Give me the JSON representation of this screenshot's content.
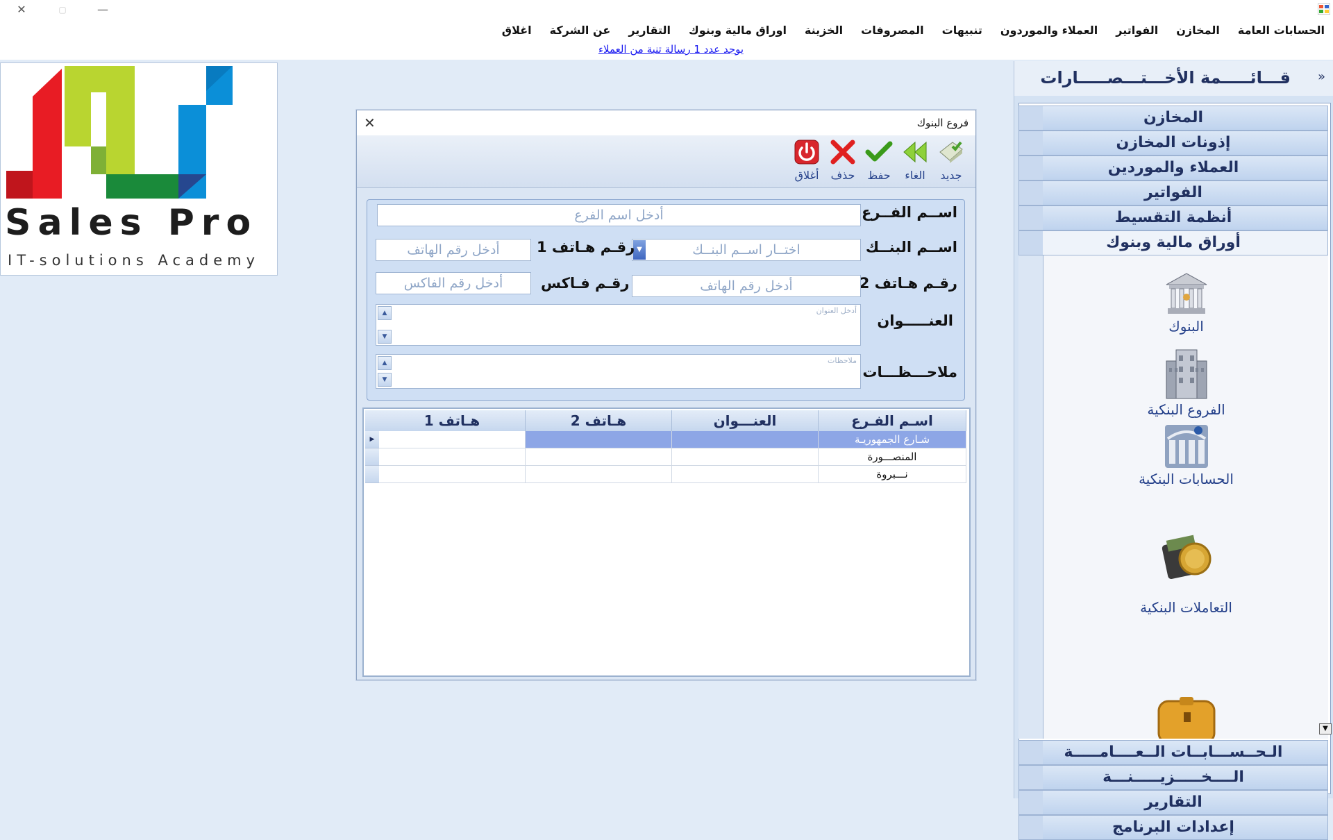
{
  "window": {
    "close_icon": "close-icon",
    "maximize_icon": "maximize-icon",
    "minimize_icon": "minimize-icon"
  },
  "menu": {
    "items": [
      "الحسابات العامة",
      "المخازن",
      "الفواتير",
      "العملاء والموردون",
      "تنبيهات",
      "المصروفات",
      "الخزينة",
      "اوراق مالية وبنوك",
      "التقارير",
      "عن الشركة",
      "اغلاق"
    ]
  },
  "notice": {
    "text": "يوجد عدد  1 رسالة تنبة من العملاء"
  },
  "logo": {
    "text": "Sales Pro",
    "subtext": "IT-solutions Academy",
    "colors": [
      "#e81c24",
      "#b9d530",
      "#1a8a3a",
      "#0b8fd8",
      "#26478f"
    ]
  },
  "sidebar": {
    "title": "قـــائـــــمة الأخـــتـــصـــــارات",
    "groups_top": [
      "المخازن",
      "إذونات المخازن",
      "العملاء والموردين",
      "الفواتير",
      "أنظمة التقسيط",
      "أوراق مالية وبنوك"
    ],
    "sub_items": [
      "البنوك",
      "الفروع البنكية",
      "الحسابات البنكية",
      "التعاملات البنكية"
    ],
    "groups_bottom": [
      "الـحــســـابــات الــعــــامـــــة",
      "الــــخـــــزيـــــنـــة",
      "التقارير",
      "إعدادات البرنامج"
    ]
  },
  "dialog": {
    "title": "فروع البنوك",
    "toolbar": {
      "new": "جديد",
      "cancel": "الغاء",
      "save": "حفظ",
      "delete": "حذف",
      "close": "أغلاق"
    },
    "form": {
      "branch_name_label": "اســم الفــرع",
      "branch_name_placeholder": "أدخل اسم الفرع",
      "bank_name_label": "اســم البنــك",
      "bank_name_placeholder": "اختــار اســم البنــك",
      "phone1_label": "رقـم هـاتف 1",
      "phone1_placeholder": "أدخل رقم الهاتف",
      "phone2_label": "رقـم هـاتف 2",
      "phone2_placeholder": "أدخل رقم الهاتف",
      "fax_label": "رقـم فـاكس",
      "fax_placeholder": "أدخل رقم الفاكس",
      "address_label": "العنـــــوان",
      "address_placeholder": "أدخل العنوان",
      "notes_label": "ملاحـــظـــات",
      "notes_placeholder": "ملاحظات"
    },
    "grid": {
      "columns": [
        "اسـم الفـرع",
        "العنـــوان",
        "هـاتف 2",
        "هـاتف 1"
      ],
      "rows": [
        {
          "branch": "شـارع الجمهوريـة",
          "address": "",
          "phone2": "",
          "phone1": ""
        },
        {
          "branch": "المنصـــورة",
          "address": "",
          "phone2": "",
          "phone1": ""
        },
        {
          "branch": "نـــبروة",
          "address": "",
          "phone2": "",
          "phone1": ""
        }
      ]
    }
  }
}
